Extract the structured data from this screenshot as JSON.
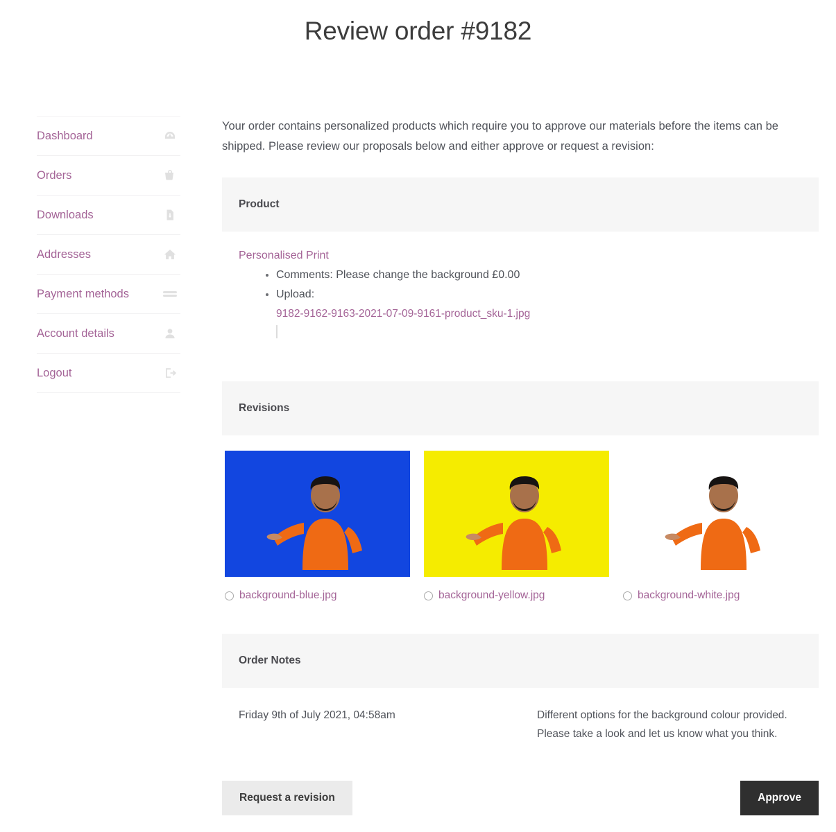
{
  "page": {
    "title": "Review order #9182",
    "intro": "Your order contains personalized products which require you to approve our materials before the items can be shipped. Please review our proposals below and either approve or request a revision:"
  },
  "sidebar": {
    "items": [
      {
        "label": "Dashboard",
        "icon": "dashboard-icon"
      },
      {
        "label": "Orders",
        "icon": "basket-icon"
      },
      {
        "label": "Downloads",
        "icon": "download-file-icon"
      },
      {
        "label": "Addresses",
        "icon": "home-icon"
      },
      {
        "label": "Payment methods",
        "icon": "credit-card-icon"
      },
      {
        "label": "Account details",
        "icon": "user-icon"
      },
      {
        "label": "Logout",
        "icon": "logout-icon"
      }
    ]
  },
  "product_panel": {
    "heading": "Product",
    "product_name": "Personalised Print",
    "meta": [
      "Comments: Please change the background £0.00",
      "Upload:"
    ],
    "upload_file": "9182-9162-9163-2021-07-09-9161-product_sku-1.jpg"
  },
  "revisions_panel": {
    "heading": "Revisions",
    "options": [
      {
        "label": "background-blue.jpg",
        "bg": "#1246e0",
        "selected": false
      },
      {
        "label": "background-yellow.jpg",
        "bg": "#f5ec00",
        "selected": false
      },
      {
        "label": "background-white.jpg",
        "bg": "#ffffff",
        "selected": false
      }
    ]
  },
  "notes_panel": {
    "heading": "Order Notes",
    "note": {
      "date": "Friday 9th of July 2021, 04:58am",
      "line1": "Different options for the background colour provided.",
      "line2": "Please take a look and let us know what you think."
    }
  },
  "actions": {
    "request_revision": "Request a revision",
    "approve": "Approve"
  },
  "colors": {
    "link": "#a46497",
    "panel_head_bg": "#f6f6f6",
    "approve_bg": "#2f2f2f",
    "secondary_bg": "#ebebeb"
  }
}
